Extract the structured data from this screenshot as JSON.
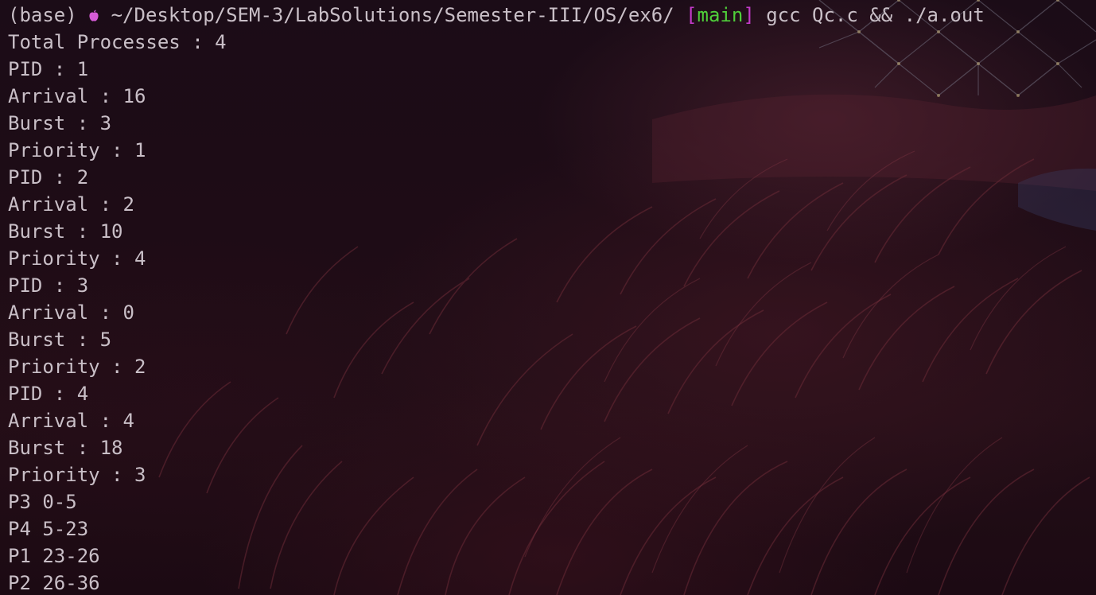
{
  "prompt": {
    "env": "(base)",
    "apple_icon": "apple-icon",
    "path": "~/Desktop/SEM-3/LabSolutions/Semester-III/OS/ex6/",
    "branch_open": "[",
    "branch": "main",
    "branch_close": "]",
    "command": "gcc Qc.c && ./a.out"
  },
  "output": [
    "Total Processes : 4",
    "PID : 1",
    "Arrival : 16",
    "Burst : 3",
    "Priority : 1",
    "PID : 2",
    "Arrival : 2",
    "Burst : 10",
    "Priority : 4",
    "PID : 3",
    "Arrival : 0",
    "Burst : 5",
    "Priority : 2",
    "PID : 4",
    "Arrival : 4",
    "Burst : 18",
    "Priority : 3",
    "P3 0-5",
    "P4 5-23",
    "P1 23-26",
    "P2 26-36"
  ],
  "colors": {
    "text": "#c9bfc7",
    "apple": "#d55bd6",
    "branch_bracket": "#c33bc9",
    "branch_name": "#4fcf3a",
    "background": "#170a14"
  }
}
